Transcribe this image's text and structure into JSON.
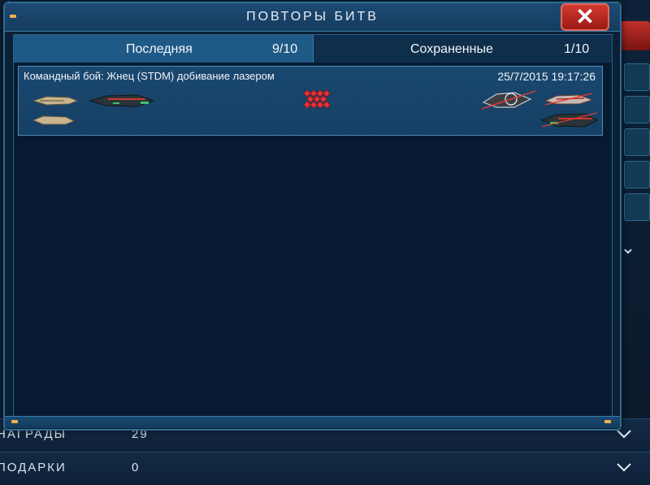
{
  "dialog": {
    "title": "ПОВТОРЫ БИТВ",
    "close_label": "✕"
  },
  "tabs": [
    {
      "label": "Последняя",
      "count": "9/10",
      "active": true
    },
    {
      "label": "Сохраненные",
      "count": "1/10",
      "active": false
    }
  ],
  "replays": [
    {
      "name": "Командный бой: Жнец (STDM) добивание лазером",
      "datetime": "25/7/2015 19:17:26"
    }
  ],
  "background": {
    "rows": [
      {
        "label": "НАГРАДЫ",
        "value": "29"
      },
      {
        "label": "ПОДАРКИ",
        "value": "0"
      }
    ]
  },
  "colors": {
    "accent": "#1f5a86",
    "close": "#c8302a",
    "panel": "#061b32"
  },
  "icons": {
    "close": "close-icon",
    "chevron": "chevron-down-icon",
    "versus": "versus-icon"
  }
}
